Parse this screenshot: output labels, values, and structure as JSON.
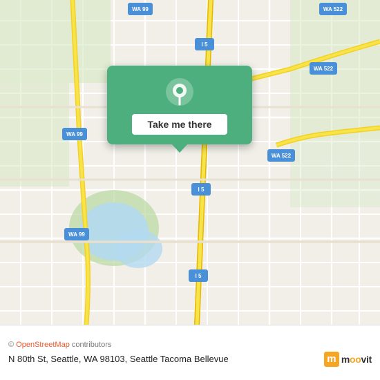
{
  "map": {
    "background_color": "#f2efe9",
    "road_color": "#ffffff",
    "highway_color": "#f5e97d",
    "green_area_color": "#c8e6c9",
    "water_color": "#b3d9f0"
  },
  "popup": {
    "button_label": "Take me there",
    "background_color": "#4caf7d"
  },
  "attribution": {
    "prefix": "© ",
    "link_text": "OpenStreetMap",
    "suffix": " contributors"
  },
  "location": {
    "address": "N 80th St, Seattle, WA 98103, Seattle Tacoma Bellevue"
  },
  "moovit": {
    "logo_letter": "m",
    "logo_text": "moovit"
  },
  "routes": {
    "wa99_labels": [
      "WA 99",
      "WA 99",
      "WA 99"
    ],
    "wa522_labels": [
      "WA 522",
      "WA 522"
    ],
    "i5_labels": [
      "I 5",
      "I 5",
      "I 5"
    ]
  }
}
